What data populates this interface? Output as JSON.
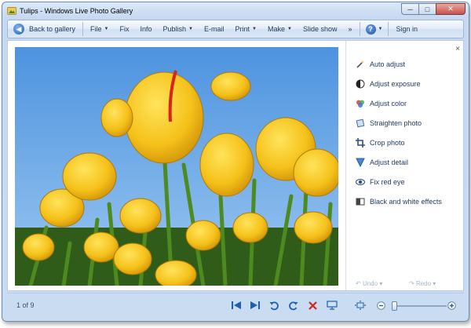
{
  "window": {
    "title": "Tulips - Windows Live Photo Gallery",
    "controls": [
      "minimize-icon",
      "maximize-icon",
      "close-icon"
    ]
  },
  "toolbar": {
    "back_label": "Back to gallery",
    "file_label": "File",
    "fix_label": "Fix",
    "info_label": "Info",
    "publish_label": "Publish",
    "email_label": "E-mail",
    "print_label": "Print",
    "make_label": "Make",
    "slideshow_label": "Slide show",
    "more_label": "»",
    "help_label": "?",
    "signin_label": "Sign in"
  },
  "photo": {
    "name": "Tulips",
    "sky_color": "#5b9fe3",
    "petal_color": "#f5c518",
    "stem_color": "#4d8a1f"
  },
  "fix_panel": {
    "close_label": "×",
    "items": [
      {
        "label": "Auto adjust",
        "icon": "magic-wand-icon"
      },
      {
        "label": "Adjust exposure",
        "icon": "exposure-icon"
      },
      {
        "label": "Adjust color",
        "icon": "color-wheel-icon"
      },
      {
        "label": "Straighten photo",
        "icon": "straighten-icon"
      },
      {
        "label": "Crop photo",
        "icon": "crop-icon"
      },
      {
        "label": "Adjust detail",
        "icon": "detail-icon"
      },
      {
        "label": "Fix red eye",
        "icon": "red-eye-icon"
      },
      {
        "label": "Black and white effects",
        "icon": "black-white-icon"
      }
    ],
    "undo_label": "Undo",
    "redo_label": "Redo"
  },
  "status": {
    "count": "1 of 9"
  }
}
